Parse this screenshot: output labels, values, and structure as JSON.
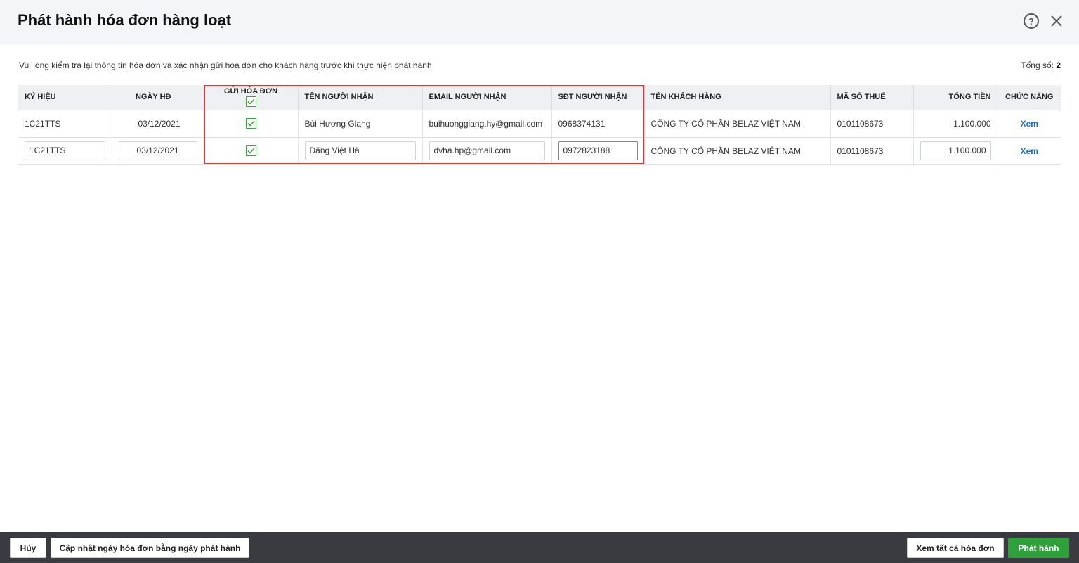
{
  "dialog": {
    "title": "Phát hành hóa đơn hàng loạt",
    "help_glyph": "?",
    "info_text": "Vui lòng kiểm tra lại thông tin hóa đơn và xác nhận gửi hóa đơn cho khách hàng trước khi thực hiện phát hành",
    "total_label": "Tổng số:",
    "total_value": "2"
  },
  "table": {
    "headers": {
      "ky_hieu": "KÝ HIỆU",
      "ngay_hd": "NGÀY HĐ",
      "gui_hoa_don": "GỬI HÓA ĐƠN",
      "ten_nguoi_nhan": "TÊN NGƯỜI NHẬN",
      "email_nguoi_nhan": "EMAIL NGƯỜI NHẬN",
      "sdt_nguoi_nhan": "SĐT NGƯỜI NHẬN",
      "ten_khach_hang": "TÊN KHÁCH HÀNG",
      "ma_so_thue": "MÃ SỐ THUẾ",
      "tong_tien": "TỔNG TIỀN",
      "chuc_nang": "CHỨC NĂNG"
    },
    "header_send_checked": true,
    "rows": [
      {
        "ky_hieu": "1C21TTS",
        "ngay_hd": "03/12/2021",
        "send": true,
        "ten_nguoi_nhan": "Bùi Hương Giang",
        "email": "buihuonggiang.hy@gmail.com",
        "sdt": "0968374131",
        "ten_khach_hang": "CÔNG TY CỔ PHẦN BELAZ VIỆT NAM",
        "ma_so_thue": "0101108673",
        "tong_tien": "1.100.000",
        "action": "Xem"
      },
      {
        "ky_hieu": "1C21TTS",
        "ngay_hd": "03/12/2021",
        "send": true,
        "ten_nguoi_nhan": "Đặng Việt Hà",
        "email": "dvha.hp@gmail.com",
        "sdt": "0972823188",
        "ten_khach_hang": "CÔNG TY CỔ PHẦN BELAZ VIỆT NAM",
        "ma_so_thue": "0101108673",
        "tong_tien": "1.100.000",
        "action": "Xem"
      }
    ]
  },
  "footer": {
    "cancel": "Hủy",
    "update_date": "Cập nhật ngày hóa đơn bằng ngày phát hành",
    "view_all": "Xem tất cả hóa đơn",
    "publish": "Phát hành"
  },
  "colors": {
    "accent_green": "#2fa13a",
    "highlight_red": "#d9383a",
    "link_blue": "#1a6fc8",
    "footer_bg": "#393b40"
  }
}
